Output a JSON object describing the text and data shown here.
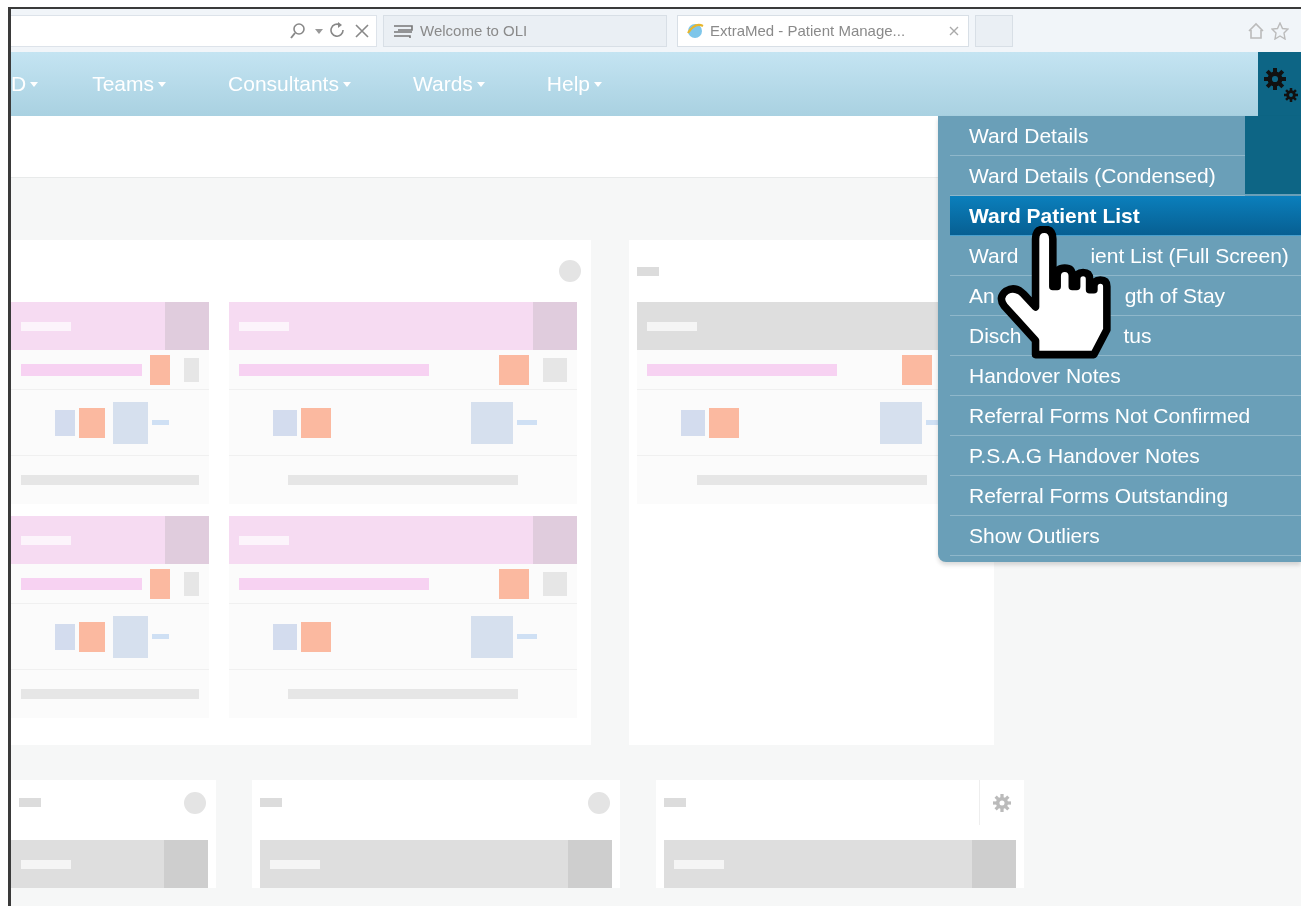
{
  "browser": {
    "tabs": [
      {
        "title": "Welcome to OLI",
        "selected": false
      },
      {
        "title": "ExtraMed - Patient Manage...",
        "selected": true
      }
    ]
  },
  "nav": {
    "items": [
      {
        "label": "D"
      },
      {
        "label": "Teams"
      },
      {
        "label": "Consultants"
      },
      {
        "label": "Wards"
      },
      {
        "label": "Help"
      }
    ]
  },
  "menu": {
    "items": [
      {
        "label": "Ward Details",
        "selected": false
      },
      {
        "label": "Ward Details (Condensed)",
        "selected": false
      },
      {
        "label": "Ward Patient List",
        "selected": true
      },
      {
        "parts": [
          "Ward",
          "ient List (Full Screen)"
        ],
        "selected": false
      },
      {
        "parts": [
          "An",
          "gth of Stay"
        ],
        "selected": false
      },
      {
        "parts": [
          "Disch",
          "tus"
        ],
        "selected": false
      },
      {
        "label": "Handover Notes",
        "selected": false
      },
      {
        "label": "Referral Forms Not Confirmed",
        "selected": false
      },
      {
        "label": "P.S.A.G Handover Notes",
        "selected": false
      },
      {
        "label": "Referral Forms Outstanding",
        "selected": false
      },
      {
        "label": "Show Outliers",
        "selected": false
      }
    ]
  },
  "ward_rows": [
    {
      "panels": [
        {
          "cards": [
            {
              "color": "#f6dbf2"
            },
            {
              "color": "#f6dbf2"
            },
            {
              "color": "#f6dbf2"
            },
            {
              "color": "#f6dbf2"
            }
          ]
        },
        {
          "cards": [
            {
              "color": "#dedede"
            }
          ]
        }
      ]
    },
    {
      "panels": [
        {
          "cards": [
            {
              "color": "#dedede"
            }
          ]
        },
        {
          "cards": [
            {
              "color": "#dedede"
            }
          ]
        },
        {
          "cards": [
            {
              "color": "#dedede"
            }
          ]
        }
      ]
    }
  ]
}
